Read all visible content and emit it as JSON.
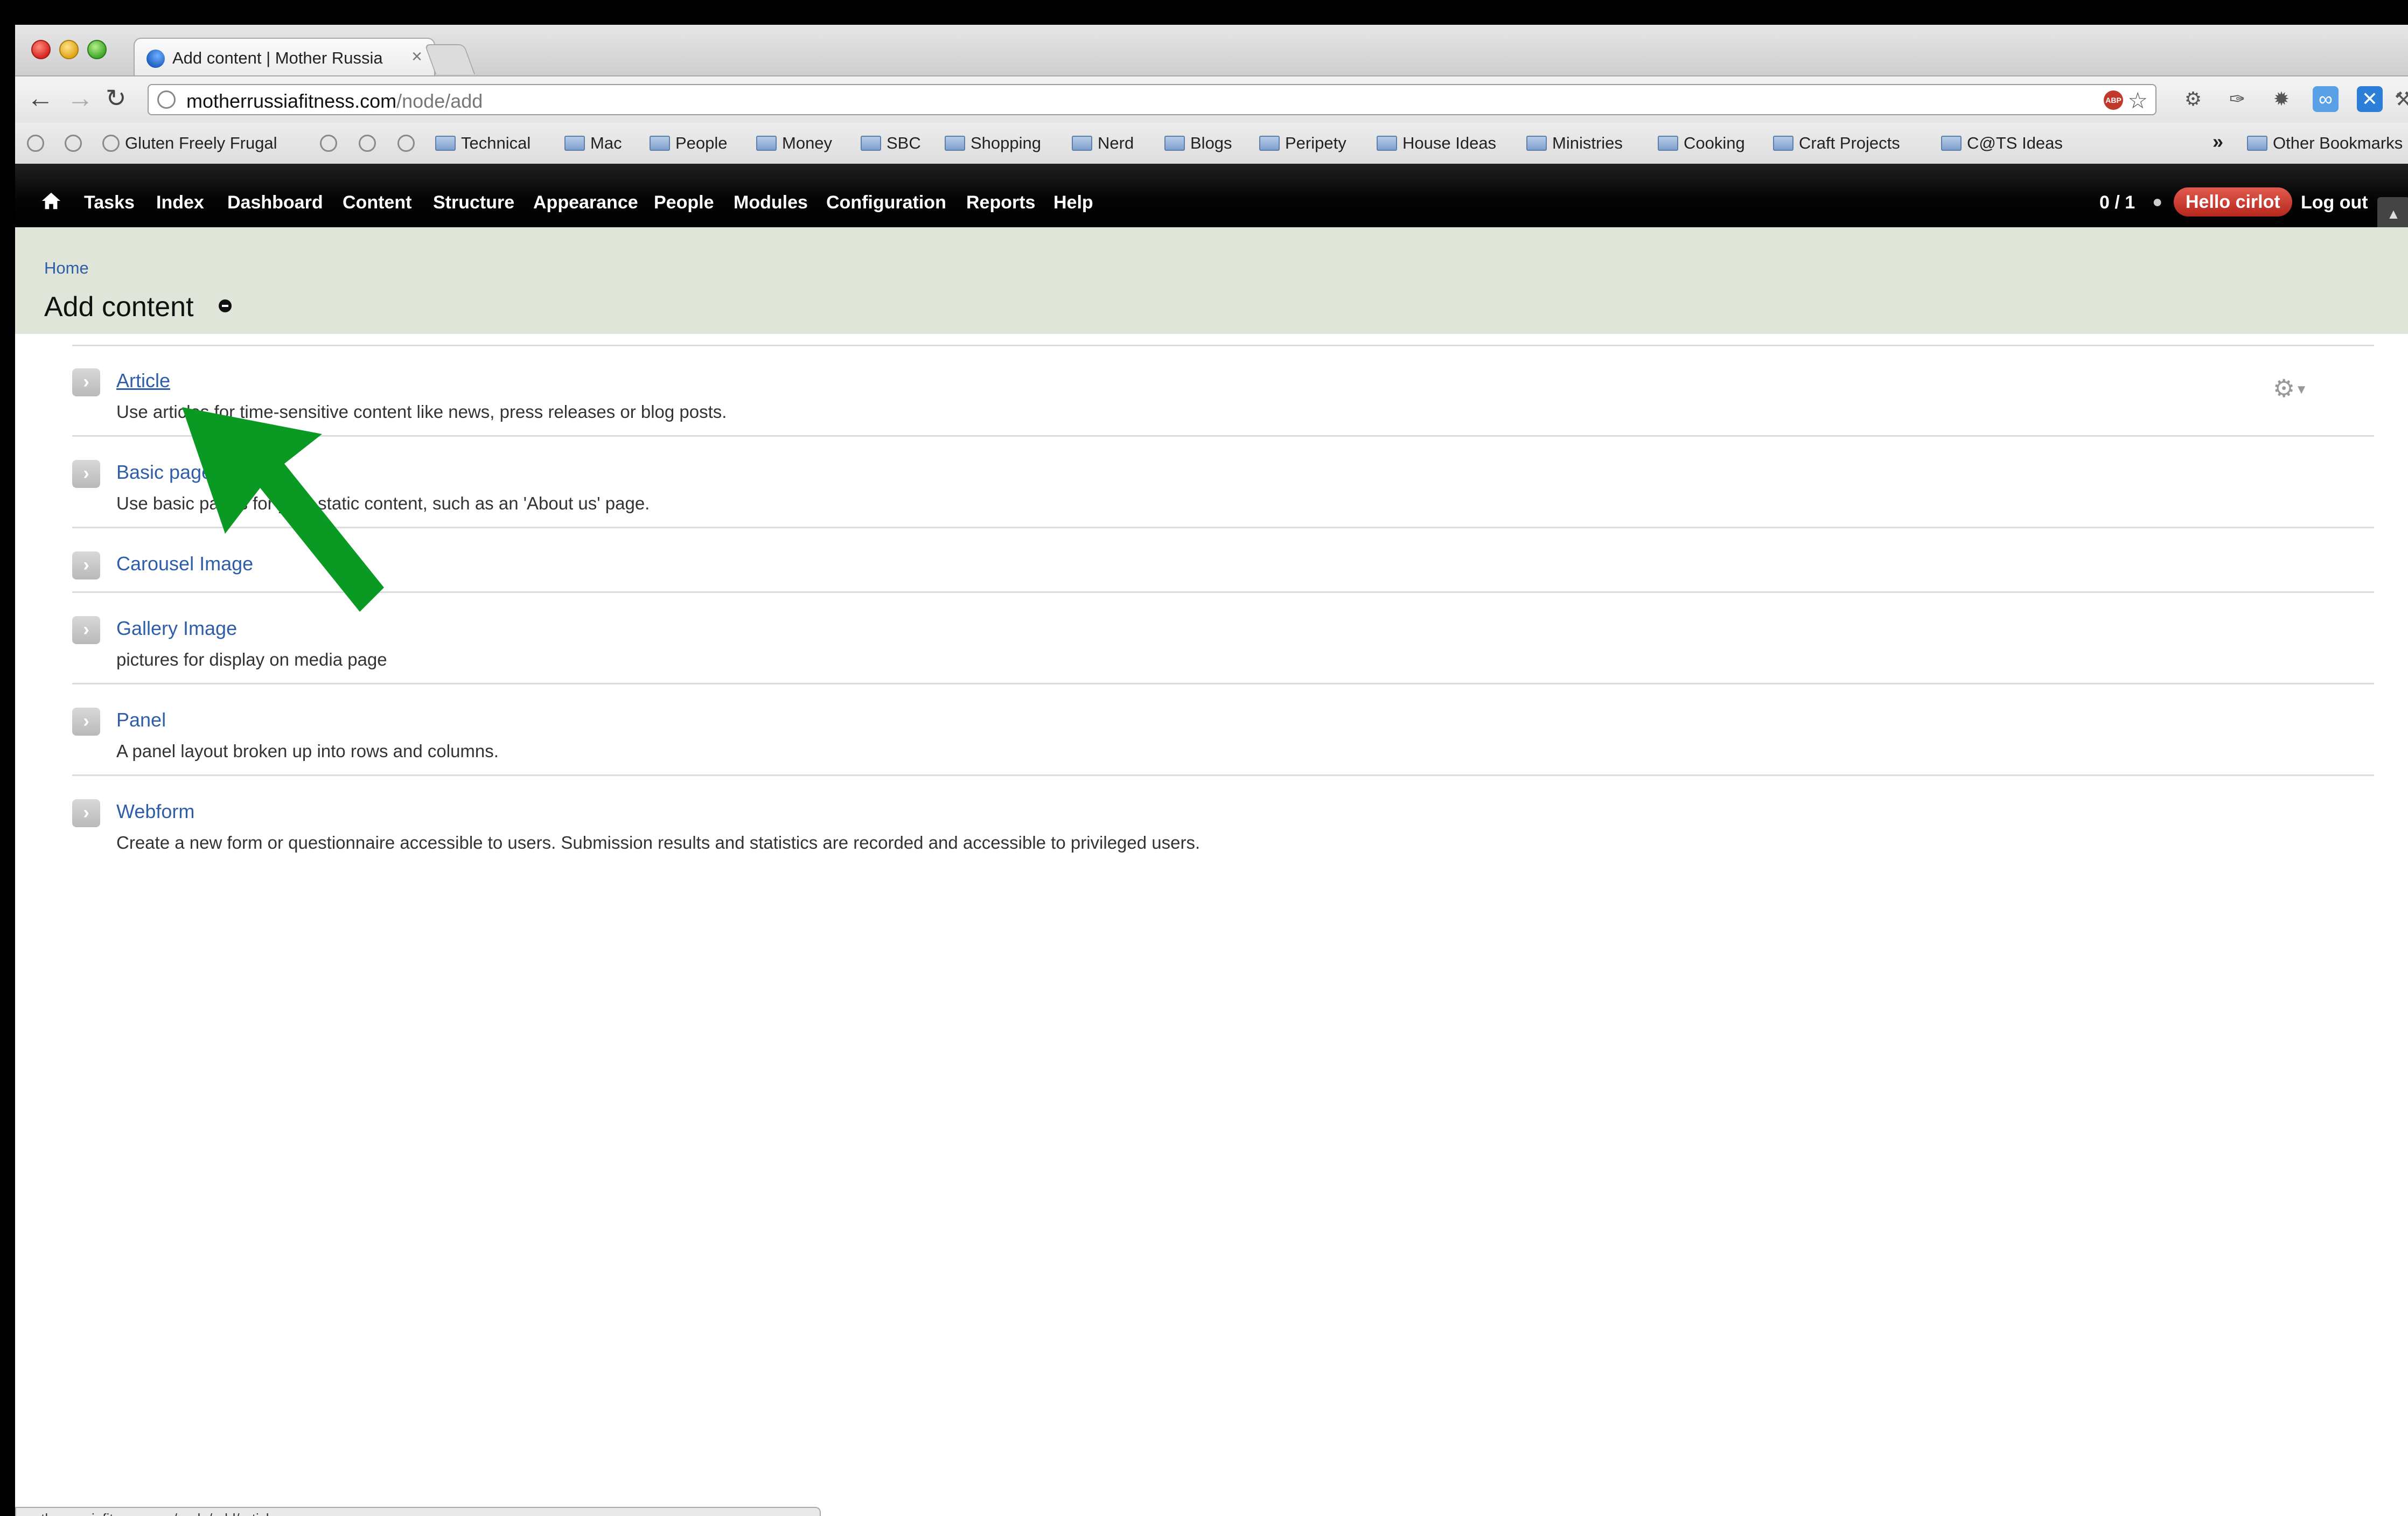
{
  "browser": {
    "tab_title": "Add content | Mother Russia",
    "tab_close": "×",
    "url_host": "motherrussiafitness.com",
    "url_path": "/node/add",
    "abp_label": "ABP",
    "status_url": "motherrussiafitness.com/node/add/article"
  },
  "bookmarks": {
    "items": [
      "Gluten Freely Frugal",
      "Technical",
      "Mac",
      "People",
      "Money",
      "SBC",
      "Shopping",
      "Nerd",
      "Blogs",
      "Peripety",
      "House Ideas",
      "Ministries",
      "Cooking",
      "Craft Projects",
      "C@TS Ideas"
    ],
    "more": "»",
    "other": "Other Bookmarks"
  },
  "admin_menu": {
    "items": [
      "Tasks",
      "Index",
      "Dashboard",
      "Content",
      "Structure",
      "Appearance",
      "People",
      "Modules",
      "Configuration",
      "Reports",
      "Help"
    ],
    "counter": "0 / 1",
    "hello": "Hello cirlot",
    "logout": "Log out"
  },
  "page": {
    "breadcrumb": "Home",
    "title": "Add content"
  },
  "content_types": [
    {
      "label": "Article",
      "desc": "Use articles for time-sensitive content like news, press releases or blog posts."
    },
    {
      "label": "Basic page",
      "desc": "Use basic pages for your static content, such as an 'About us' page."
    },
    {
      "label": "Carousel Image",
      "desc": ""
    },
    {
      "label": "Gallery Image",
      "desc": "pictures for display on media page"
    },
    {
      "label": "Panel",
      "desc": "A panel layout broken up into rows and columns."
    },
    {
      "label": "Webform",
      "desc": "Create a new form or questionnaire accessible to users. Submission results and statistics are recorded and accessible to privileged users."
    }
  ],
  "colors": {
    "link": "#2f5ea8",
    "annotation_arrow": "#0a9a23",
    "header_bg": "#dfe5d8",
    "hello_badge": "#c8352a"
  },
  "icons": [
    "home-icon",
    "back-icon",
    "forward-icon",
    "reload-icon",
    "globe-icon",
    "star-icon",
    "gear-icon",
    "folder-icon",
    "chevron-right-icon",
    "arrow-annotation-icon"
  ]
}
